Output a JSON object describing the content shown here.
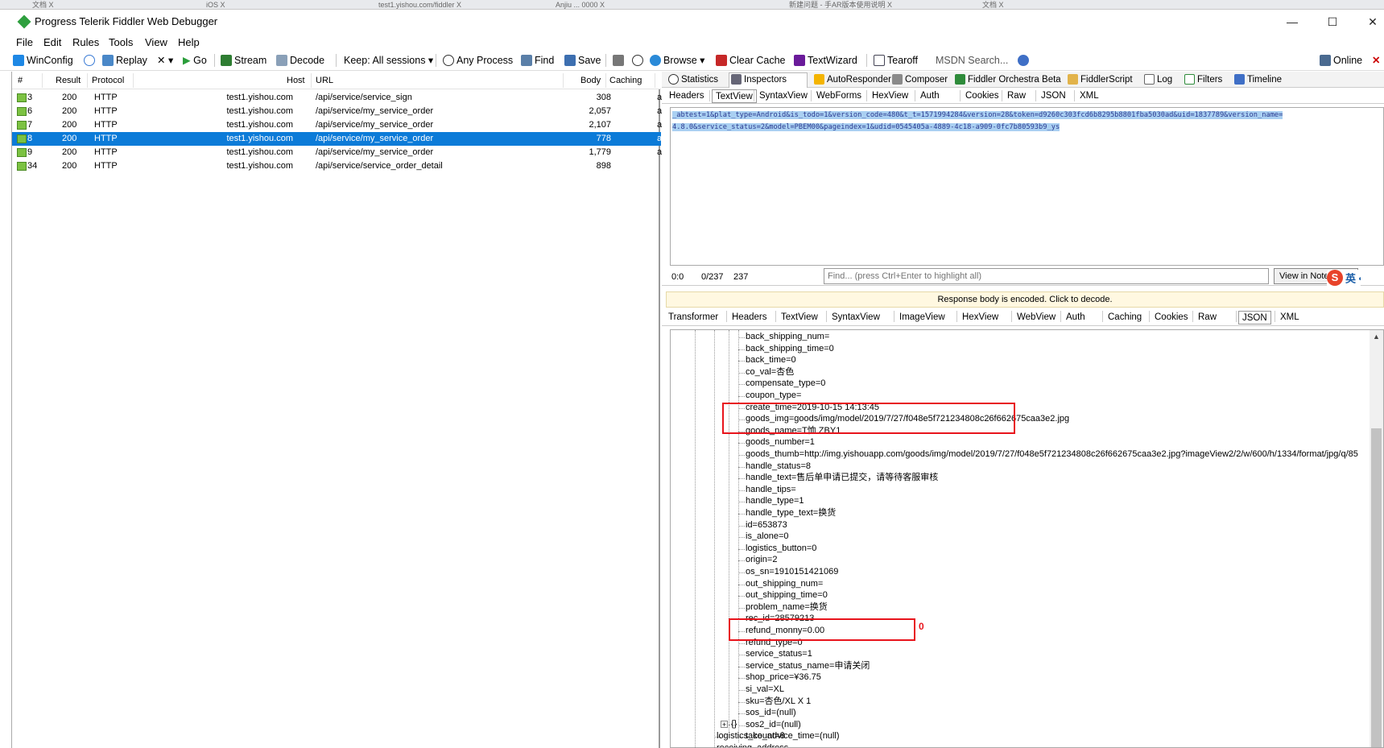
{
  "browser_tabs": [
    {
      "label": "文档 X"
    },
    {
      "label": "iOS X"
    },
    {
      "label": "test1.yishou.com/fiddler X"
    },
    {
      "label": "Anjiu ... 0000 X"
    },
    {
      "label": "新建问题 - 手AR版本使用说明 X"
    },
    {
      "label": "文档 X"
    }
  ],
  "window": {
    "title": "Progress Telerik Fiddler Web Debugger",
    "min": "—",
    "max": "☐",
    "close": "✕"
  },
  "menu": [
    "File",
    "Edit",
    "Rules",
    "Tools",
    "View",
    "Help"
  ],
  "toolbar": {
    "winconfig": "WinConfig",
    "replay": "Replay",
    "remove": "✕ ▾",
    "go": "Go",
    "stream": "Stream",
    "decode": "Decode",
    "keep": "Keep: All sessions ▾",
    "any_process": "Any Process",
    "find": "Find",
    "save": "Save",
    "browse": "Browse ▾",
    "clear_cache": "Clear Cache",
    "textwizard": "TextWizard",
    "tearoff": "Tearoff",
    "msdn_search": "MSDN Search...",
    "online": "Online",
    "online_close": "✕"
  },
  "sessions": {
    "columns": [
      "#",
      "Result",
      "Protocol",
      "Host",
      "URL",
      "Body",
      "Caching"
    ],
    "rows": [
      {
        "id": "3",
        "result": "200",
        "protocol": "HTTP",
        "host": "test1.yishou.com",
        "url": "/api/service/service_sign",
        "body": "308",
        "caching": "",
        "trail": "a",
        "selected": false
      },
      {
        "id": "6",
        "result": "200",
        "protocol": "HTTP",
        "host": "test1.yishou.com",
        "url": "/api/service/my_service_order",
        "body": "2,057",
        "caching": "",
        "trail": "a",
        "selected": false
      },
      {
        "id": "7",
        "result": "200",
        "protocol": "HTTP",
        "host": "test1.yishou.com",
        "url": "/api/service/my_service_order",
        "body": "2,107",
        "caching": "",
        "trail": "a",
        "selected": false
      },
      {
        "id": "8",
        "result": "200",
        "protocol": "HTTP",
        "host": "test1.yishou.com",
        "url": "/api/service/my_service_order",
        "body": "778",
        "caching": "",
        "trail": "a",
        "selected": true
      },
      {
        "id": "9",
        "result": "200",
        "protocol": "HTTP",
        "host": "test1.yishou.com",
        "url": "/api/service/my_service_order",
        "body": "1,779",
        "caching": "",
        "trail": "a",
        "selected": false
      },
      {
        "id": "34",
        "result": "200",
        "protocol": "HTTP",
        "host": "test1.yishou.com",
        "url": "/api/service/service_order_detail",
        "body": "898",
        "caching": "",
        "trail": "",
        "selected": false
      }
    ]
  },
  "top_tabs": [
    "Statistics",
    "Inspectors",
    "AutoResponder",
    "Composer",
    "Fiddler Orchestra Beta",
    "FiddlerScript",
    "Log",
    "Filters",
    "Timeline"
  ],
  "top_tabs_active": "Inspectors",
  "request_tabs": [
    "Headers",
    "TextView",
    "SyntaxView",
    "WebForms",
    "HexView",
    "Auth",
    "Cookies",
    "Raw",
    "JSON",
    "XML"
  ],
  "request_tabs_active": "TextView",
  "request_body": {
    "line1": "_abtest=1&plat_type=Android&is_todo=1&version_code=480&t_t=1571994284&version=28&token=d9260c303fcd6b8295b8801fba5030ad&uid=1837789&version_name=",
    "line2": "4.8.0&service_status=2&model=PBEM00&pageindex=1&udid=0545405a-4889-4c18-a909-0fc7b80593b9_ys"
  },
  "request_status": {
    "pos": "0:0",
    "sel": "0/237",
    "len": "237",
    "find_placeholder": "Find... (press Ctrl+Enter to highlight all)",
    "view_notepad": "View in Notepad"
  },
  "ime": {
    "s": "S",
    "lang": "英 •,"
  },
  "encoded_notice": "Response body is encoded. Click to decode.",
  "response_tabs": [
    "Transformer",
    "Headers",
    "TextView",
    "SyntaxView",
    "ImageView",
    "HexView",
    "WebView",
    "Auth",
    "Caching",
    "Cookies",
    "Raw",
    "JSON",
    "XML"
  ],
  "response_tabs_active": "JSON",
  "json_fields": [
    "back_shipping_num=",
    "back_shipping_time=0",
    "back_time=0",
    "co_val=杏色",
    "compensate_type=0",
    "coupon_type=",
    "create_time=2019-10-15 14:13:45",
    "goods_img=goods/img/model/2019/7/27/f048e5f721234808c26f662675caa3e2.jpg",
    "goods_name=T恤 ZBY1",
    "goods_number=1",
    "goods_thumb=http://img.yishouapp.com/goods/img/model/2019/7/27/f048e5f721234808c26f662675caa3e2.jpg?imageView2/2/w/600/h/1334/format/jpg/q/85",
    "handle_status=8",
    "handle_text=售后单申请已提交，请等待客服审核",
    "handle_tips=",
    "handle_type=1",
    "handle_type_text=换货",
    "id=653873",
    "is_alone=0",
    "logistics_button=0",
    "origin=2",
    "os_sn=1910151421069",
    "out_shipping_num=",
    "out_shipping_time=0",
    "problem_name=换货",
    "rec_id=28579213",
    "refund_monny=0.00",
    "refund_type=0",
    "service_status=1",
    "service_status_name=申请关闭",
    "shop_price=¥36.75",
    "si_val=XL",
    "sku=杏色/XL X 1",
    "sos_id=(null)",
    "sos2_id=(null)",
    "take_advice_time=(null)"
  ],
  "json_tail": {
    "expander": "+",
    "braces": "{}",
    "logistics_count": "logistics_count=8",
    "receiving_address": "receiving_address"
  },
  "annotation_mark": "0"
}
